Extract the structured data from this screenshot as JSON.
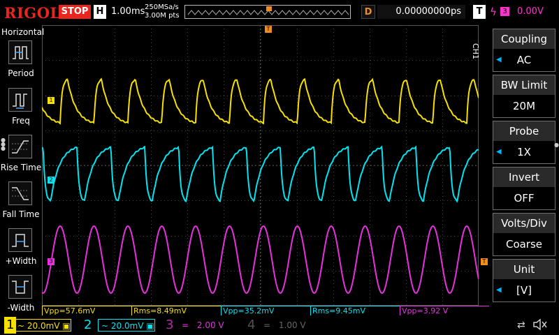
{
  "topbar": {
    "logo": "RIGOL",
    "run_state": "STOP",
    "h_label": "H",
    "timebase": "1.00ms",
    "sample_rate": "250MSa/s",
    "memory_depth": "3.00M pts",
    "d_label": "D",
    "delay": "0.00000000ps",
    "t_label": "T",
    "trigger_source": "3",
    "trigger_level": "0.00V"
  },
  "left_panel": {
    "title": "Horizontal",
    "items": [
      {
        "label": "Period",
        "icon": "period-icon"
      },
      {
        "label": "Freq",
        "icon": "freq-icon"
      },
      {
        "label": "Rise Time",
        "icon": "rise-time-icon"
      },
      {
        "label": "Fall Time",
        "icon": "fall-time-icon"
      },
      {
        "label": "+Width",
        "icon": "pos-width-icon"
      },
      {
        "label": "-Width",
        "icon": "neg-width-icon"
      }
    ]
  },
  "right_panel": {
    "channel_tag": "CH1",
    "menus": [
      {
        "title": "Coupling",
        "value": "AC"
      },
      {
        "title": "BW Limit",
        "value": "20M"
      },
      {
        "title": "Probe",
        "value": "1X"
      },
      {
        "title": "Invert",
        "value": "OFF"
      },
      {
        "title": "Volts/Div",
        "value": "Coarse"
      },
      {
        "title": "Unit",
        "value": "[V]"
      }
    ]
  },
  "measurements": [
    {
      "text": "Vpp=57.6mV",
      "color": "#f5e000"
    },
    {
      "text": "Rms=8.49mV",
      "color": "#f5e000"
    },
    {
      "text": "Vpp=35.2mV",
      "color": "#00e5f0"
    },
    {
      "text": "Rms=9.45mV",
      "color": "#00e5f0"
    },
    {
      "text": "Vpp=3.92 V",
      "color": "#e830e0"
    }
  ],
  "channels": [
    {
      "num": "1",
      "scale": "20.0mV",
      "coupling_icon": "~",
      "color": "#f5e000",
      "active": true
    },
    {
      "num": "2",
      "scale": "20.0mV",
      "coupling_icon": "~",
      "color": "#00e5f0",
      "active": true
    },
    {
      "num": "3",
      "scale": "2.00 V",
      "coupling_icon": "=",
      "color": "#e830e0",
      "active": false
    },
    {
      "num": "4",
      "scale": "1.00 V",
      "coupling_icon": "=",
      "color": "#666666",
      "active": false
    }
  ],
  "markers": {
    "ch1": "1",
    "ch2": "2",
    "ch3": "3",
    "trigger": "T"
  },
  "status_icons": [
    "usb-icon",
    "speaker-muted-icon"
  ]
}
